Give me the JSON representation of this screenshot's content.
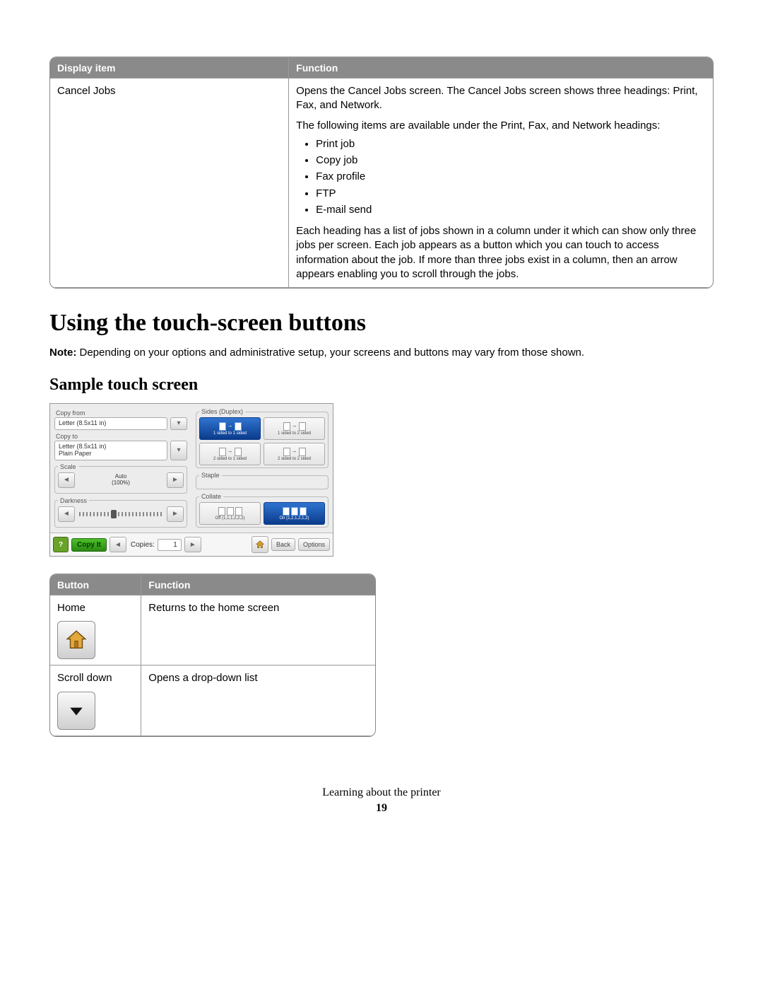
{
  "table1": {
    "headers": [
      "Display item",
      "Function"
    ],
    "row": {
      "display_item": "Cancel Jobs",
      "p1": "Opens the Cancel Jobs screen. The Cancel Jobs screen shows three headings: Print, Fax, and Network.",
      "p2": "The following items are available under the Print, Fax, and Network headings:",
      "bullets": [
        "Print job",
        "Copy job",
        "Fax profile",
        "FTP",
        "E-mail send"
      ],
      "p3": "Each heading has a list of jobs shown in a column under it which can show only three jobs per screen. Each job appears as a button which you can touch to access information about the job. If more than three jobs exist in a column, then an arrow appears enabling you to scroll through the jobs."
    }
  },
  "heading1": "Using the touch-screen buttons",
  "note_label": "Note:",
  "note_text": " Depending on your options and administrative setup, your screens and buttons may vary from those shown.",
  "heading2": "Sample touch screen",
  "screenshot": {
    "copy_from_label": "Copy from",
    "copy_from_value": "Letter (8.5x11 in)",
    "copy_to_label": "Copy to",
    "copy_to_value_line1": "Letter (8.5x11 in)",
    "copy_to_value_line2": "Plain Paper",
    "scale_label": "Scale",
    "scale_value_line1": "Auto",
    "scale_value_line2": "(100%)",
    "darkness_label": "Darkness",
    "sides_label": "Sides (Duplex)",
    "side_opts": [
      "1 sided to 1 sided",
      "1 sided to 2 sided",
      "2 sided to 1 sided",
      "2 sided to 2 sided"
    ],
    "staple_label": "Staple",
    "collate_label": "Collate",
    "collate_opts": [
      "Off (1,1,1,2,2,2)",
      "On (1,2,1,2,1,2)"
    ],
    "copyit": "Copy It",
    "copies_label": "Copies:",
    "copies_value": "1",
    "back": "Back",
    "options": "Options"
  },
  "table2": {
    "headers": [
      "Button",
      "Function"
    ],
    "rows": [
      {
        "button": "Home",
        "function": "Returns to the home screen"
      },
      {
        "button": "Scroll down",
        "function": "Opens a drop-down list"
      }
    ]
  },
  "footer": {
    "section": "Learning about the printer",
    "page": "19"
  }
}
